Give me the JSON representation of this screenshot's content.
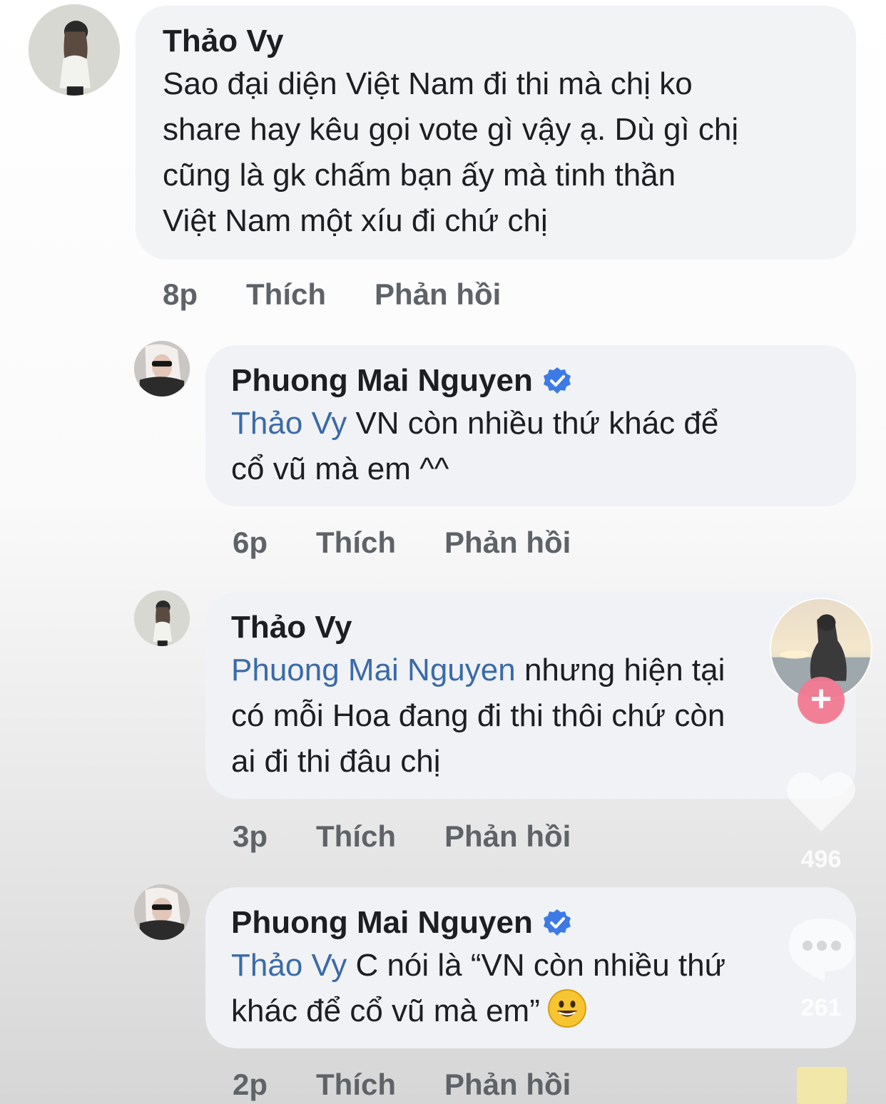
{
  "comments": [
    {
      "author": "Thảo Vy",
      "verified": false,
      "mention": "",
      "text_lines": [
        "Sao đại diện Việt Nam đi thi mà chị ko",
        "share hay kêu gọi vote gì vậy ạ. Dù gì chị",
        "cũng là gk chấm bạn ấy mà tinh thần",
        "Việt Nam một xíu đi chứ chị"
      ],
      "time": "8p",
      "like_label": "Thích",
      "reply_label": "Phản hồi"
    },
    {
      "author": "Phuong Mai Nguyen",
      "verified": true,
      "mention": "Thảo Vy",
      "text_lines": [
        " VN còn nhiều thứ khác để",
        "cổ vũ mà em ^^"
      ],
      "time": "6p",
      "like_label": "Thích",
      "reply_label": "Phản hồi"
    },
    {
      "author": "Thảo Vy",
      "verified": false,
      "mention": "Phuong Mai Nguyen",
      "text_lines": [
        " nhưng hiện tại",
        "có mỗi Hoa đang đi thi thôi chứ còn",
        "ai đi thi đâu chị"
      ],
      "time": "3p",
      "like_label": "Thích",
      "reply_label": "Phản hồi"
    },
    {
      "author": "Phuong Mai Nguyen",
      "verified": true,
      "mention": "Thảo Vy",
      "text_lines": [
        " C nói là “VN còn nhiều thứ",
        "khác để cổ vũ mà em”"
      ],
      "emoji": "grinning-face",
      "time": "2p",
      "like_label": "Thích",
      "reply_label": "Phản hồi"
    }
  ],
  "overlay": {
    "follow_symbol": "+",
    "likes_count": "496",
    "comments_count": "261",
    "icons": [
      "heart-icon",
      "comment-bubble-icon",
      "plus-icon",
      "music-disc-icon"
    ]
  },
  "colors": {
    "bubble": "#f0f2f5",
    "mention": "#3b6aa8",
    "verified": "#3d7ae6",
    "action_text": "#5f6368"
  }
}
